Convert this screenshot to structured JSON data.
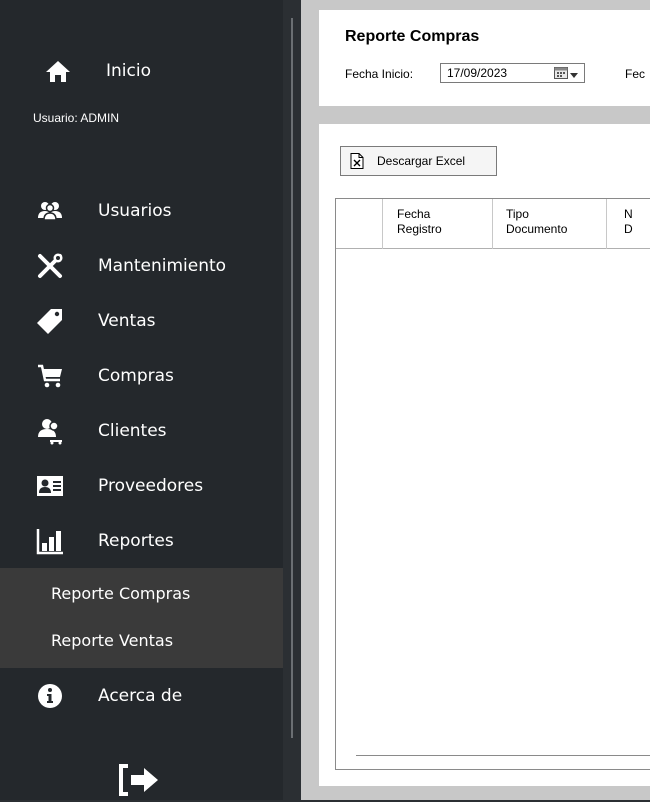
{
  "sidebar": {
    "home": {
      "label": "Inicio",
      "icon": "home-icon"
    },
    "user_label": "Usuario:",
    "user_value": "ADMIN",
    "items": [
      {
        "label": "Usuarios",
        "icon": "users-icon"
      },
      {
        "label": "Mantenimiento",
        "icon": "tools-icon"
      },
      {
        "label": "Ventas",
        "icon": "tag-icon"
      },
      {
        "label": "Compras",
        "icon": "cart-icon"
      },
      {
        "label": "Clientes",
        "icon": "clients-icon"
      },
      {
        "label": "Proveedores",
        "icon": "id-card-icon"
      },
      {
        "label": "Reportes",
        "icon": "bar-chart-icon"
      }
    ],
    "submenu": [
      {
        "label": "Reporte Compras"
      },
      {
        "label": "Reporte Ventas"
      }
    ],
    "about": {
      "label": "Acerca de",
      "icon": "info-icon"
    },
    "logout_icon": "logout-icon",
    "colors": {
      "background": "#24282c",
      "submenu": "#3a3a3a",
      "text": "#ffffff"
    }
  },
  "main": {
    "title": "Reporte Compras",
    "fecha_inicio_label": "Fecha Inicio:",
    "fecha_inicio_value": "17/09/2023",
    "fecha_fin_label": "Fec",
    "excel_button_label": "Descargar Excel",
    "grid_columns": [
      {
        "line1": "Fecha",
        "line2": "Registro"
      },
      {
        "line1": "Tipo",
        "line2": "Documento"
      },
      {
        "line1": "N",
        "line2": "D"
      }
    ],
    "colors": {
      "background": "#c8c8c8",
      "panel": "#ffffff"
    }
  }
}
